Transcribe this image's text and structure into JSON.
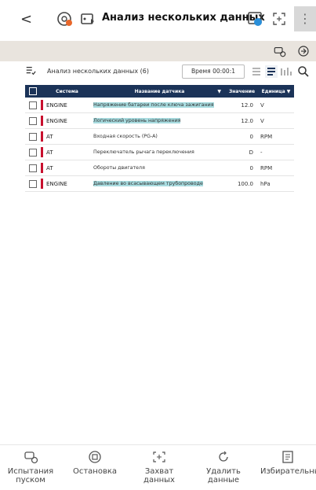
{
  "header": {
    "back_label": "<",
    "title": "Анализ нескольких данных",
    "menu_glyph": "⋮"
  },
  "toolbar": {
    "section_label": "Анализ нескольких данных (6)",
    "timer_label": "Время 00:00:1"
  },
  "table": {
    "columns": {
      "system": "Система",
      "name": "Название датчика",
      "value": "Значение",
      "unit": "Единица"
    },
    "rows": [
      {
        "system": "ENGINE",
        "name": "Напряжение батареи после ключа зажигания",
        "value": "12.0",
        "unit": "V",
        "highlighted": true
      },
      {
        "system": "ENGINE",
        "name": "Логический уровень напряжения",
        "value": "12.0",
        "unit": "V",
        "highlighted": true
      },
      {
        "system": "AT",
        "name": "Входная скорость (PG-A)",
        "value": "0",
        "unit": "RPM",
        "highlighted": false
      },
      {
        "system": "AT",
        "name": "Переключатель рычага переключения",
        "value": "D",
        "unit": "-",
        "highlighted": false
      },
      {
        "system": "AT",
        "name": "Обороты двигателя",
        "value": "0",
        "unit": "RPM",
        "highlighted": false
      },
      {
        "system": "ENGINE",
        "name": "Давление во всасывающем трубопроводе",
        "value": "100.0",
        "unit": "hPa",
        "highlighted": true
      }
    ]
  },
  "bottom_nav": [
    {
      "label": "Испытания пуском",
      "icon": "car-diagnostic-icon"
    },
    {
      "label": "Остановка",
      "icon": "stop-circle-icon"
    },
    {
      "label": "Захват данных",
      "icon": "capture-icon"
    },
    {
      "label": "Удалить данные",
      "icon": "refresh-icon"
    },
    {
      "label": "Избирательный",
      "icon": "document-filter-icon"
    }
  ],
  "colors": {
    "header_bg": "#1b3358",
    "system_marker": "#c8102e",
    "highlight": "#a8dce0",
    "subbar_bg": "#e9e4de"
  }
}
